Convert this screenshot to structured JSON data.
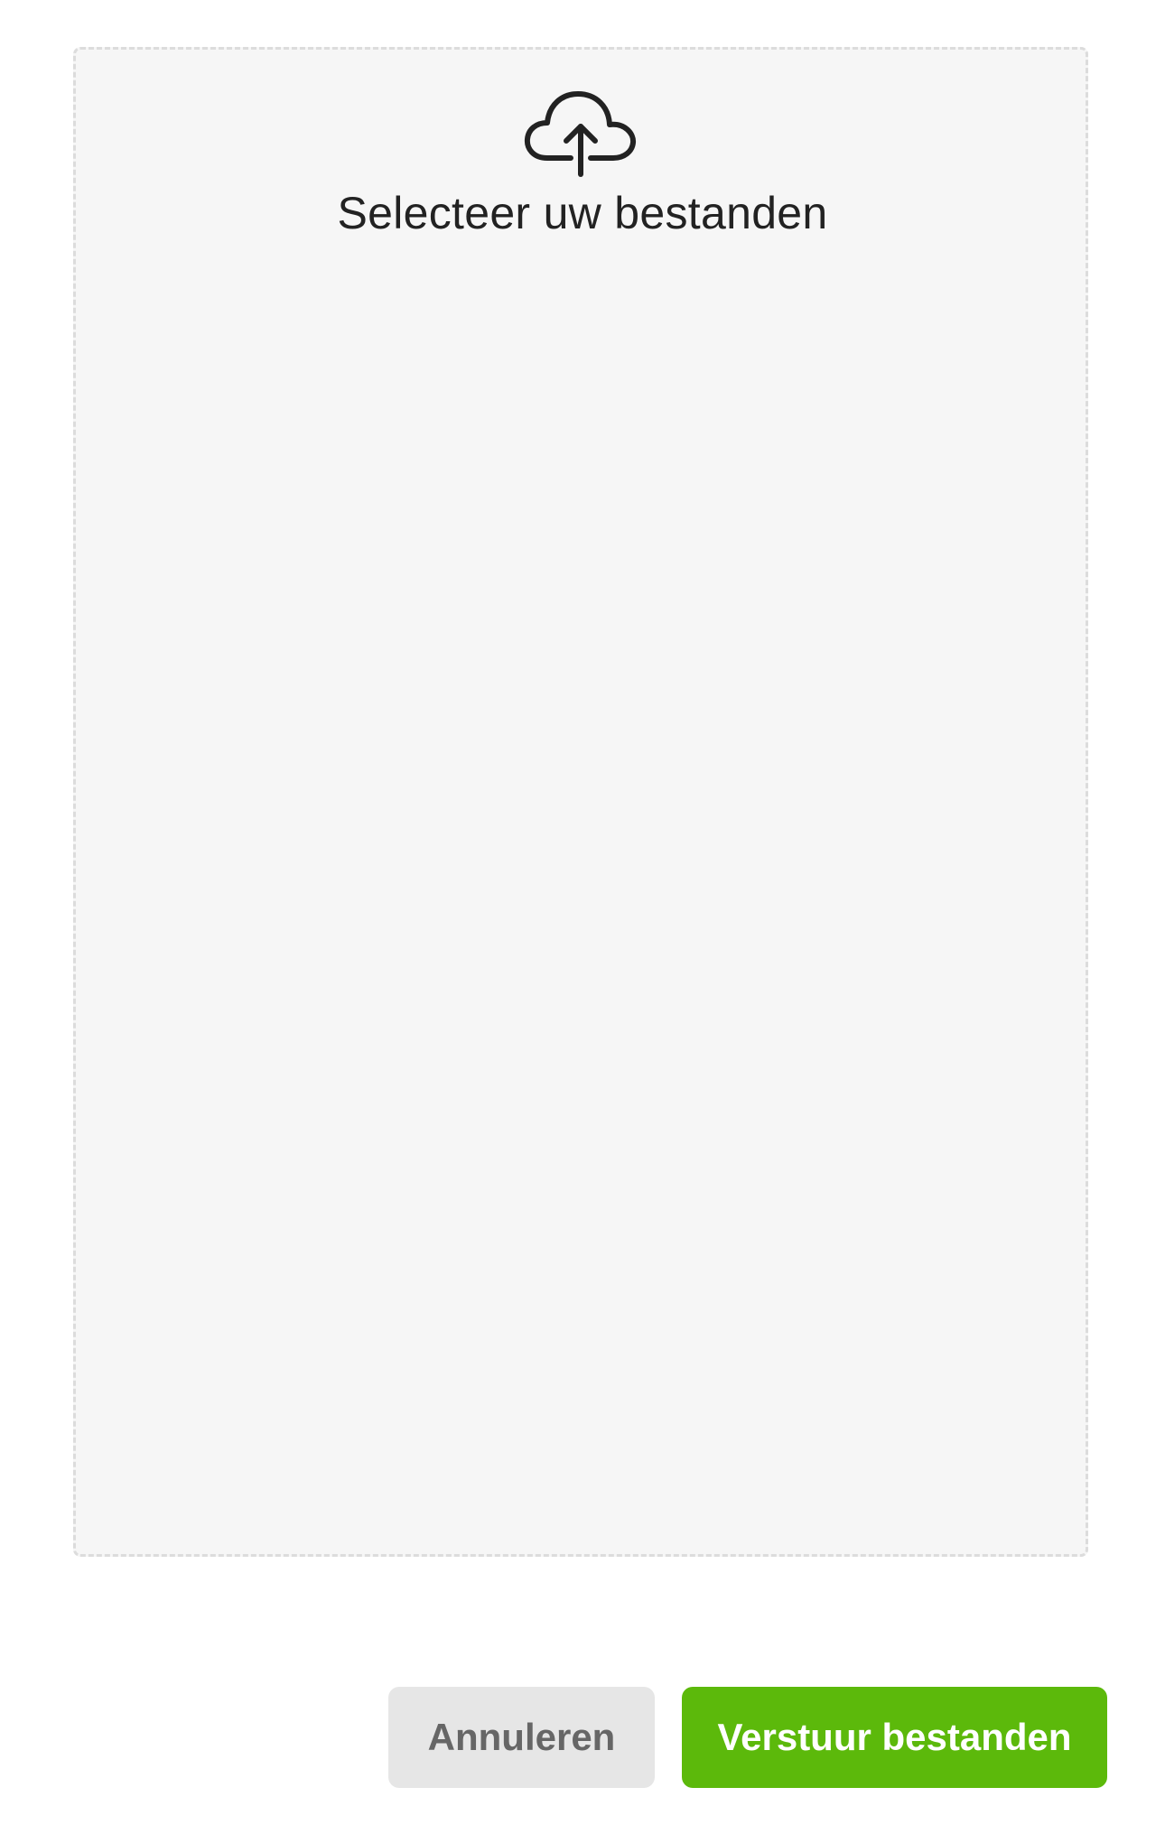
{
  "dropzone": {
    "icon": "cloud-upload-icon",
    "label": "Selecteer uw bestanden"
  },
  "actions": {
    "cancel_label": "Annuleren",
    "submit_label": "Verstuur bestanden"
  },
  "colors": {
    "accent": "#5cb90b",
    "dropzone_bg": "#f6f6f6",
    "dropzone_border": "#dcdcdc",
    "cancel_bg": "#e6e6e6",
    "cancel_text": "#666666",
    "text": "#222222"
  }
}
